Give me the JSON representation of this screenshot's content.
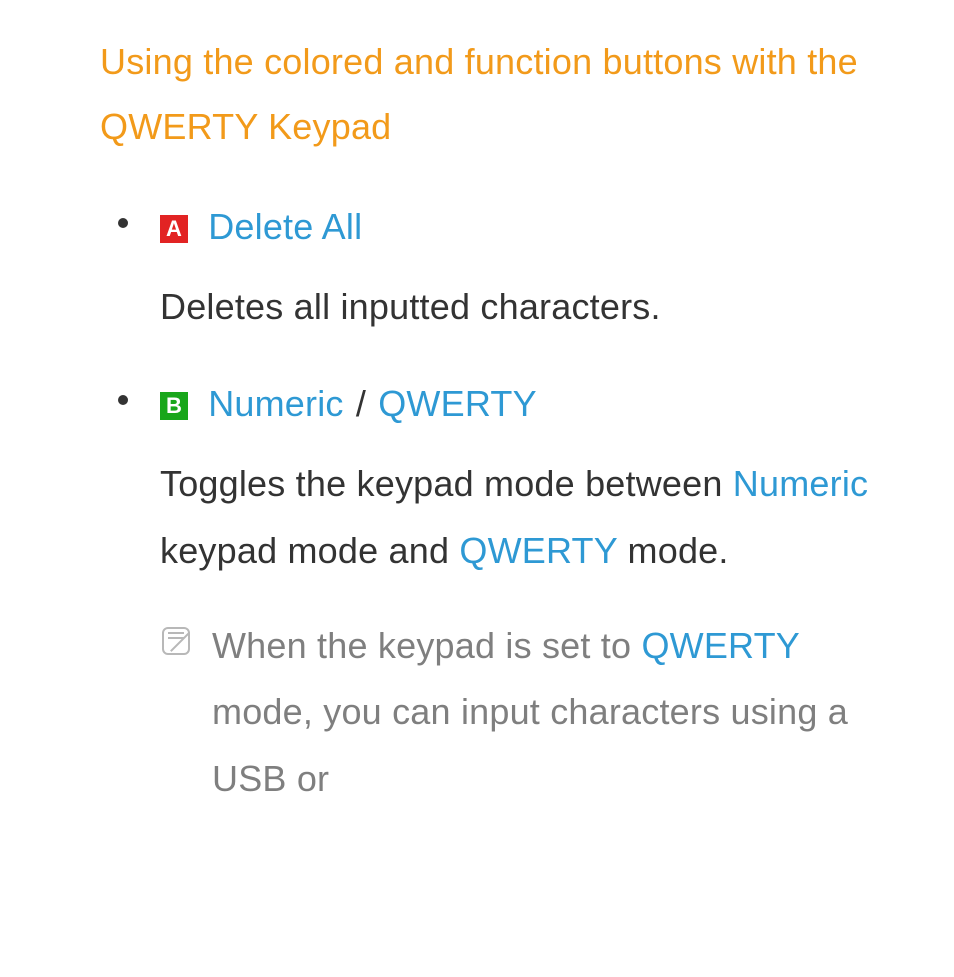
{
  "section_title": "Using the colored and function buttons with the QWERTY Keypad",
  "items": [
    {
      "badge_letter": "A",
      "badge_class": "badge-a",
      "title_terms": [
        "Delete All"
      ],
      "desc_pre": "Deletes all inputted characters.",
      "desc_hl1": "",
      "desc_mid": "",
      "desc_hl2": "",
      "desc_post": ""
    },
    {
      "badge_letter": "B",
      "badge_class": "badge-b",
      "title_terms": [
        "Numeric",
        "QWERTY"
      ],
      "desc_pre": "Toggles the keypad mode between ",
      "desc_hl1": "Numeric",
      "desc_mid": " keypad mode and ",
      "desc_hl2": "QWERTY",
      "desc_post": " mode."
    }
  ],
  "separator": " / ",
  "note": {
    "pre": "When the keypad is set to ",
    "hl": "QWERTY",
    "post": " mode, you can input characters using a USB or"
  }
}
